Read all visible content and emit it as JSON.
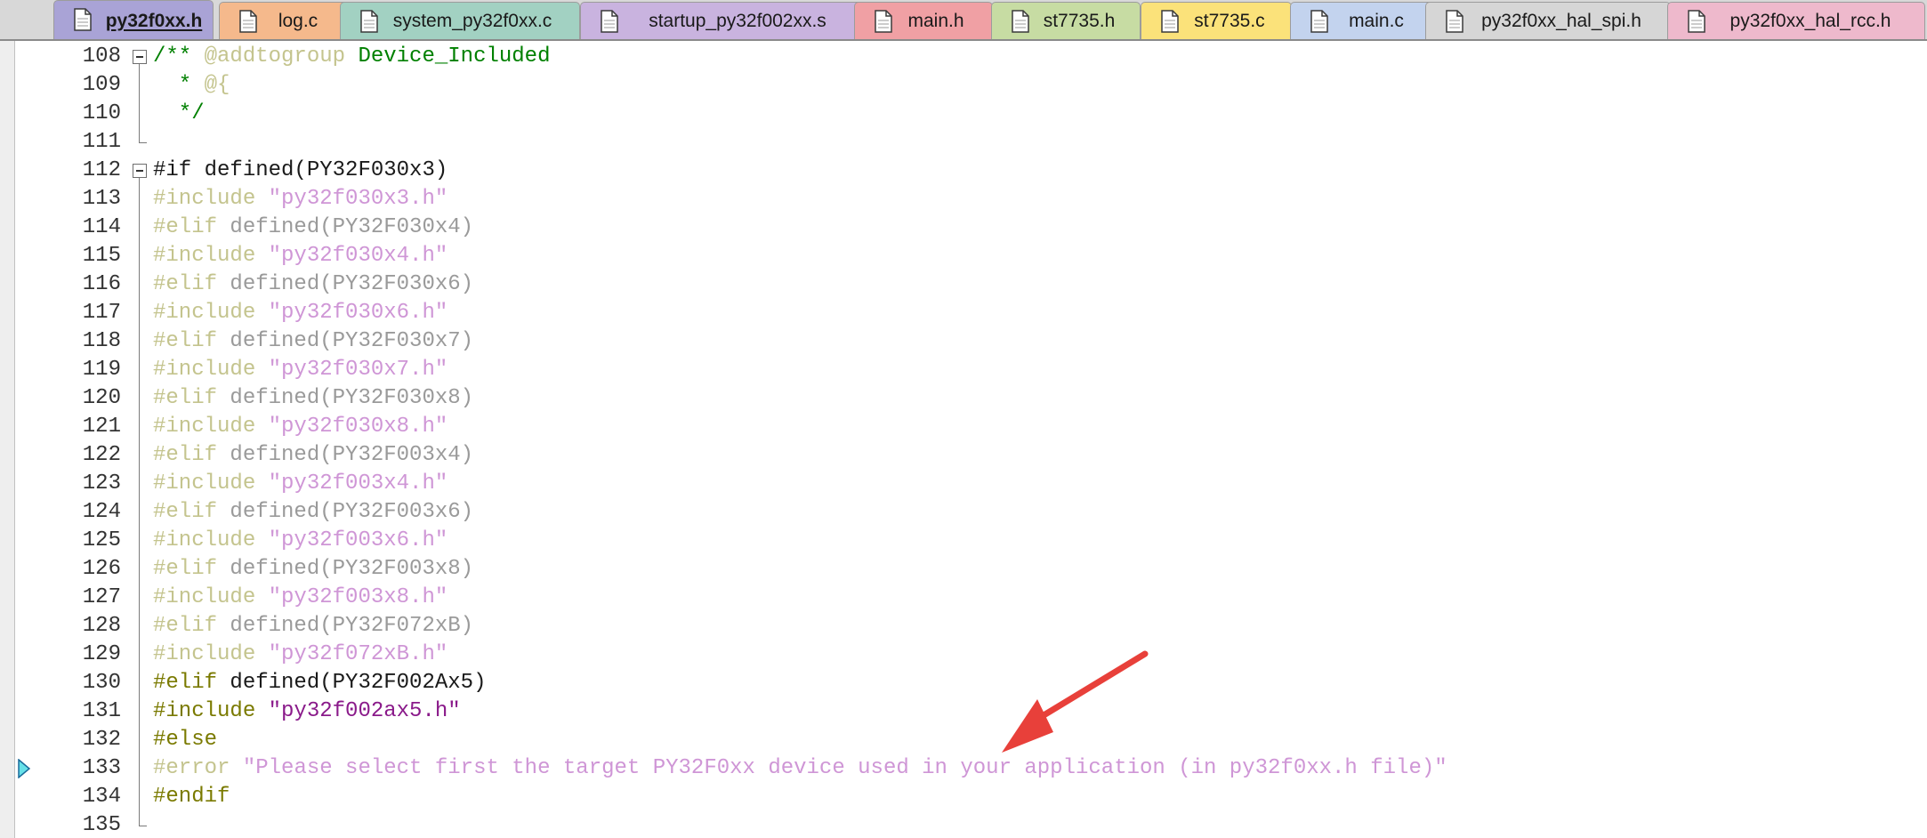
{
  "tabs": [
    {
      "label": "py32f0xx.h",
      "active": true,
      "color": "#a9a3d6"
    },
    {
      "label": "log.c",
      "active": false,
      "color": "#f5b98c"
    },
    {
      "label": "system_py32f0xx.c",
      "active": false,
      "color": "#a2d1c2"
    },
    {
      "label": "startup_py32f002xx.s",
      "active": false,
      "color": "#c9b3df"
    },
    {
      "label": "main.h",
      "active": false,
      "color": "#f0a0a4"
    },
    {
      "label": "st7735.h",
      "active": false,
      "color": "#c7dca3"
    },
    {
      "label": "st7735.c",
      "active": false,
      "color": "#fbe27a"
    },
    {
      "label": "main.c",
      "active": false,
      "color": "#c3d3ee"
    },
    {
      "label": "py32f0xx_hal_spi.h",
      "active": false,
      "color": "#d6d6d6"
    },
    {
      "label": "py32f0xx_hal_rcc.h",
      "active": false,
      "color": "#eeb9cc"
    }
  ],
  "editor": {
    "current_line": 133,
    "lines": [
      {
        "num": "108",
        "fold": "open",
        "tokens": [
          {
            "t": "/** ",
            "c": "comment"
          },
          {
            "t": "@addtogroup",
            "c": "kw-dim"
          },
          {
            "t": " Device_Included",
            "c": "comment"
          }
        ]
      },
      {
        "num": "109",
        "fold": "line",
        "tokens": [
          {
            "t": "  * ",
            "c": "comment"
          },
          {
            "t": "@{",
            "c": "kw-dim"
          }
        ]
      },
      {
        "num": "110",
        "fold": "line",
        "tokens": [
          {
            "t": "  */",
            "c": "comment"
          }
        ]
      },
      {
        "num": "111",
        "fold": "end",
        "tokens": []
      },
      {
        "num": "112",
        "fold": "open",
        "tokens": [
          {
            "t": "#if defined(PY32F030x3)",
            "c": "pp"
          }
        ]
      },
      {
        "num": "113",
        "fold": "line",
        "tokens": [
          {
            "t": "#include",
            "c": "kw-dim"
          },
          {
            "t": " ",
            "c": "ident-dim"
          },
          {
            "t": "\"py32f030x3.h\"",
            "c": "str-dim"
          }
        ]
      },
      {
        "num": "114",
        "fold": "line",
        "tokens": [
          {
            "t": "#elif",
            "c": "kw-dim"
          },
          {
            "t": " defined(PY32F030x4)",
            "c": "ident-dim"
          }
        ]
      },
      {
        "num": "115",
        "fold": "line",
        "tokens": [
          {
            "t": "#include",
            "c": "kw-dim"
          },
          {
            "t": " ",
            "c": "ident-dim"
          },
          {
            "t": "\"py32f030x4.h\"",
            "c": "str-dim"
          }
        ]
      },
      {
        "num": "116",
        "fold": "line",
        "tokens": [
          {
            "t": "#elif",
            "c": "kw-dim"
          },
          {
            "t": " defined(PY32F030x6)",
            "c": "ident-dim"
          }
        ]
      },
      {
        "num": "117",
        "fold": "line",
        "tokens": [
          {
            "t": "#include",
            "c": "kw-dim"
          },
          {
            "t": " ",
            "c": "ident-dim"
          },
          {
            "t": "\"py32f030x6.h\"",
            "c": "str-dim"
          }
        ]
      },
      {
        "num": "118",
        "fold": "line",
        "tokens": [
          {
            "t": "#elif",
            "c": "kw-dim"
          },
          {
            "t": " defined(PY32F030x7)",
            "c": "ident-dim"
          }
        ]
      },
      {
        "num": "119",
        "fold": "line",
        "tokens": [
          {
            "t": "#include",
            "c": "kw-dim"
          },
          {
            "t": " ",
            "c": "ident-dim"
          },
          {
            "t": "\"py32f030x7.h\"",
            "c": "str-dim"
          }
        ]
      },
      {
        "num": "120",
        "fold": "line",
        "tokens": [
          {
            "t": "#elif",
            "c": "kw-dim"
          },
          {
            "t": " defined(PY32F030x8)",
            "c": "ident-dim"
          }
        ]
      },
      {
        "num": "121",
        "fold": "line",
        "tokens": [
          {
            "t": "#include",
            "c": "kw-dim"
          },
          {
            "t": " ",
            "c": "ident-dim"
          },
          {
            "t": "\"py32f030x8.h\"",
            "c": "str-dim"
          }
        ]
      },
      {
        "num": "122",
        "fold": "line",
        "tokens": [
          {
            "t": "#elif",
            "c": "kw-dim"
          },
          {
            "t": " defined(PY32F003x4)",
            "c": "ident-dim"
          }
        ]
      },
      {
        "num": "123",
        "fold": "line",
        "tokens": [
          {
            "t": "#include",
            "c": "kw-dim"
          },
          {
            "t": " ",
            "c": "ident-dim"
          },
          {
            "t": "\"py32f003x4.h\"",
            "c": "str-dim"
          }
        ]
      },
      {
        "num": "124",
        "fold": "line",
        "tokens": [
          {
            "t": "#elif",
            "c": "kw-dim"
          },
          {
            "t": " defined(PY32F003x6)",
            "c": "ident-dim"
          }
        ]
      },
      {
        "num": "125",
        "fold": "line",
        "tokens": [
          {
            "t": "#include",
            "c": "kw-dim"
          },
          {
            "t": " ",
            "c": "ident-dim"
          },
          {
            "t": "\"py32f003x6.h\"",
            "c": "str-dim"
          }
        ]
      },
      {
        "num": "126",
        "fold": "line",
        "tokens": [
          {
            "t": "#elif",
            "c": "kw-dim"
          },
          {
            "t": " defined(PY32F003x8)",
            "c": "ident-dim"
          }
        ]
      },
      {
        "num": "127",
        "fold": "line",
        "tokens": [
          {
            "t": "#include",
            "c": "kw-dim"
          },
          {
            "t": " ",
            "c": "ident-dim"
          },
          {
            "t": "\"py32f003x8.h\"",
            "c": "str-dim"
          }
        ]
      },
      {
        "num": "128",
        "fold": "line",
        "tokens": [
          {
            "t": "#elif",
            "c": "kw-dim"
          },
          {
            "t": " defined(PY32F072xB)",
            "c": "ident-dim"
          }
        ]
      },
      {
        "num": "129",
        "fold": "line",
        "tokens": [
          {
            "t": "#include",
            "c": "kw-dim"
          },
          {
            "t": " ",
            "c": "ident-dim"
          },
          {
            "t": "\"py32f072xB.h\"",
            "c": "str-dim"
          }
        ]
      },
      {
        "num": "130",
        "fold": "line",
        "tokens": [
          {
            "t": "#elif",
            "c": "kw"
          },
          {
            "t": " defined(PY32F002Ax5)",
            "c": "ident"
          }
        ]
      },
      {
        "num": "131",
        "fold": "line",
        "tokens": [
          {
            "t": "#include",
            "c": "kw"
          },
          {
            "t": " ",
            "c": "ident"
          },
          {
            "t": "\"py32f002ax5.h\"",
            "c": "str"
          }
        ]
      },
      {
        "num": "132",
        "fold": "line",
        "tokens": [
          {
            "t": "#else",
            "c": "kw"
          }
        ]
      },
      {
        "num": "133",
        "fold": "line",
        "tokens": [
          {
            "t": "#error",
            "c": "kw-dim"
          },
          {
            "t": " ",
            "c": "ident-dim"
          },
          {
            "t": "\"Please select first the target PY32F0xx device used in your application (in py32f0xx.h file)\"",
            "c": "str-dim"
          }
        ]
      },
      {
        "num": "134",
        "fold": "line",
        "tokens": [
          {
            "t": "#endif",
            "c": "kw"
          }
        ]
      },
      {
        "num": "135",
        "fold": "end",
        "tokens": []
      }
    ]
  },
  "annotation": {
    "color": "#e8403a"
  }
}
